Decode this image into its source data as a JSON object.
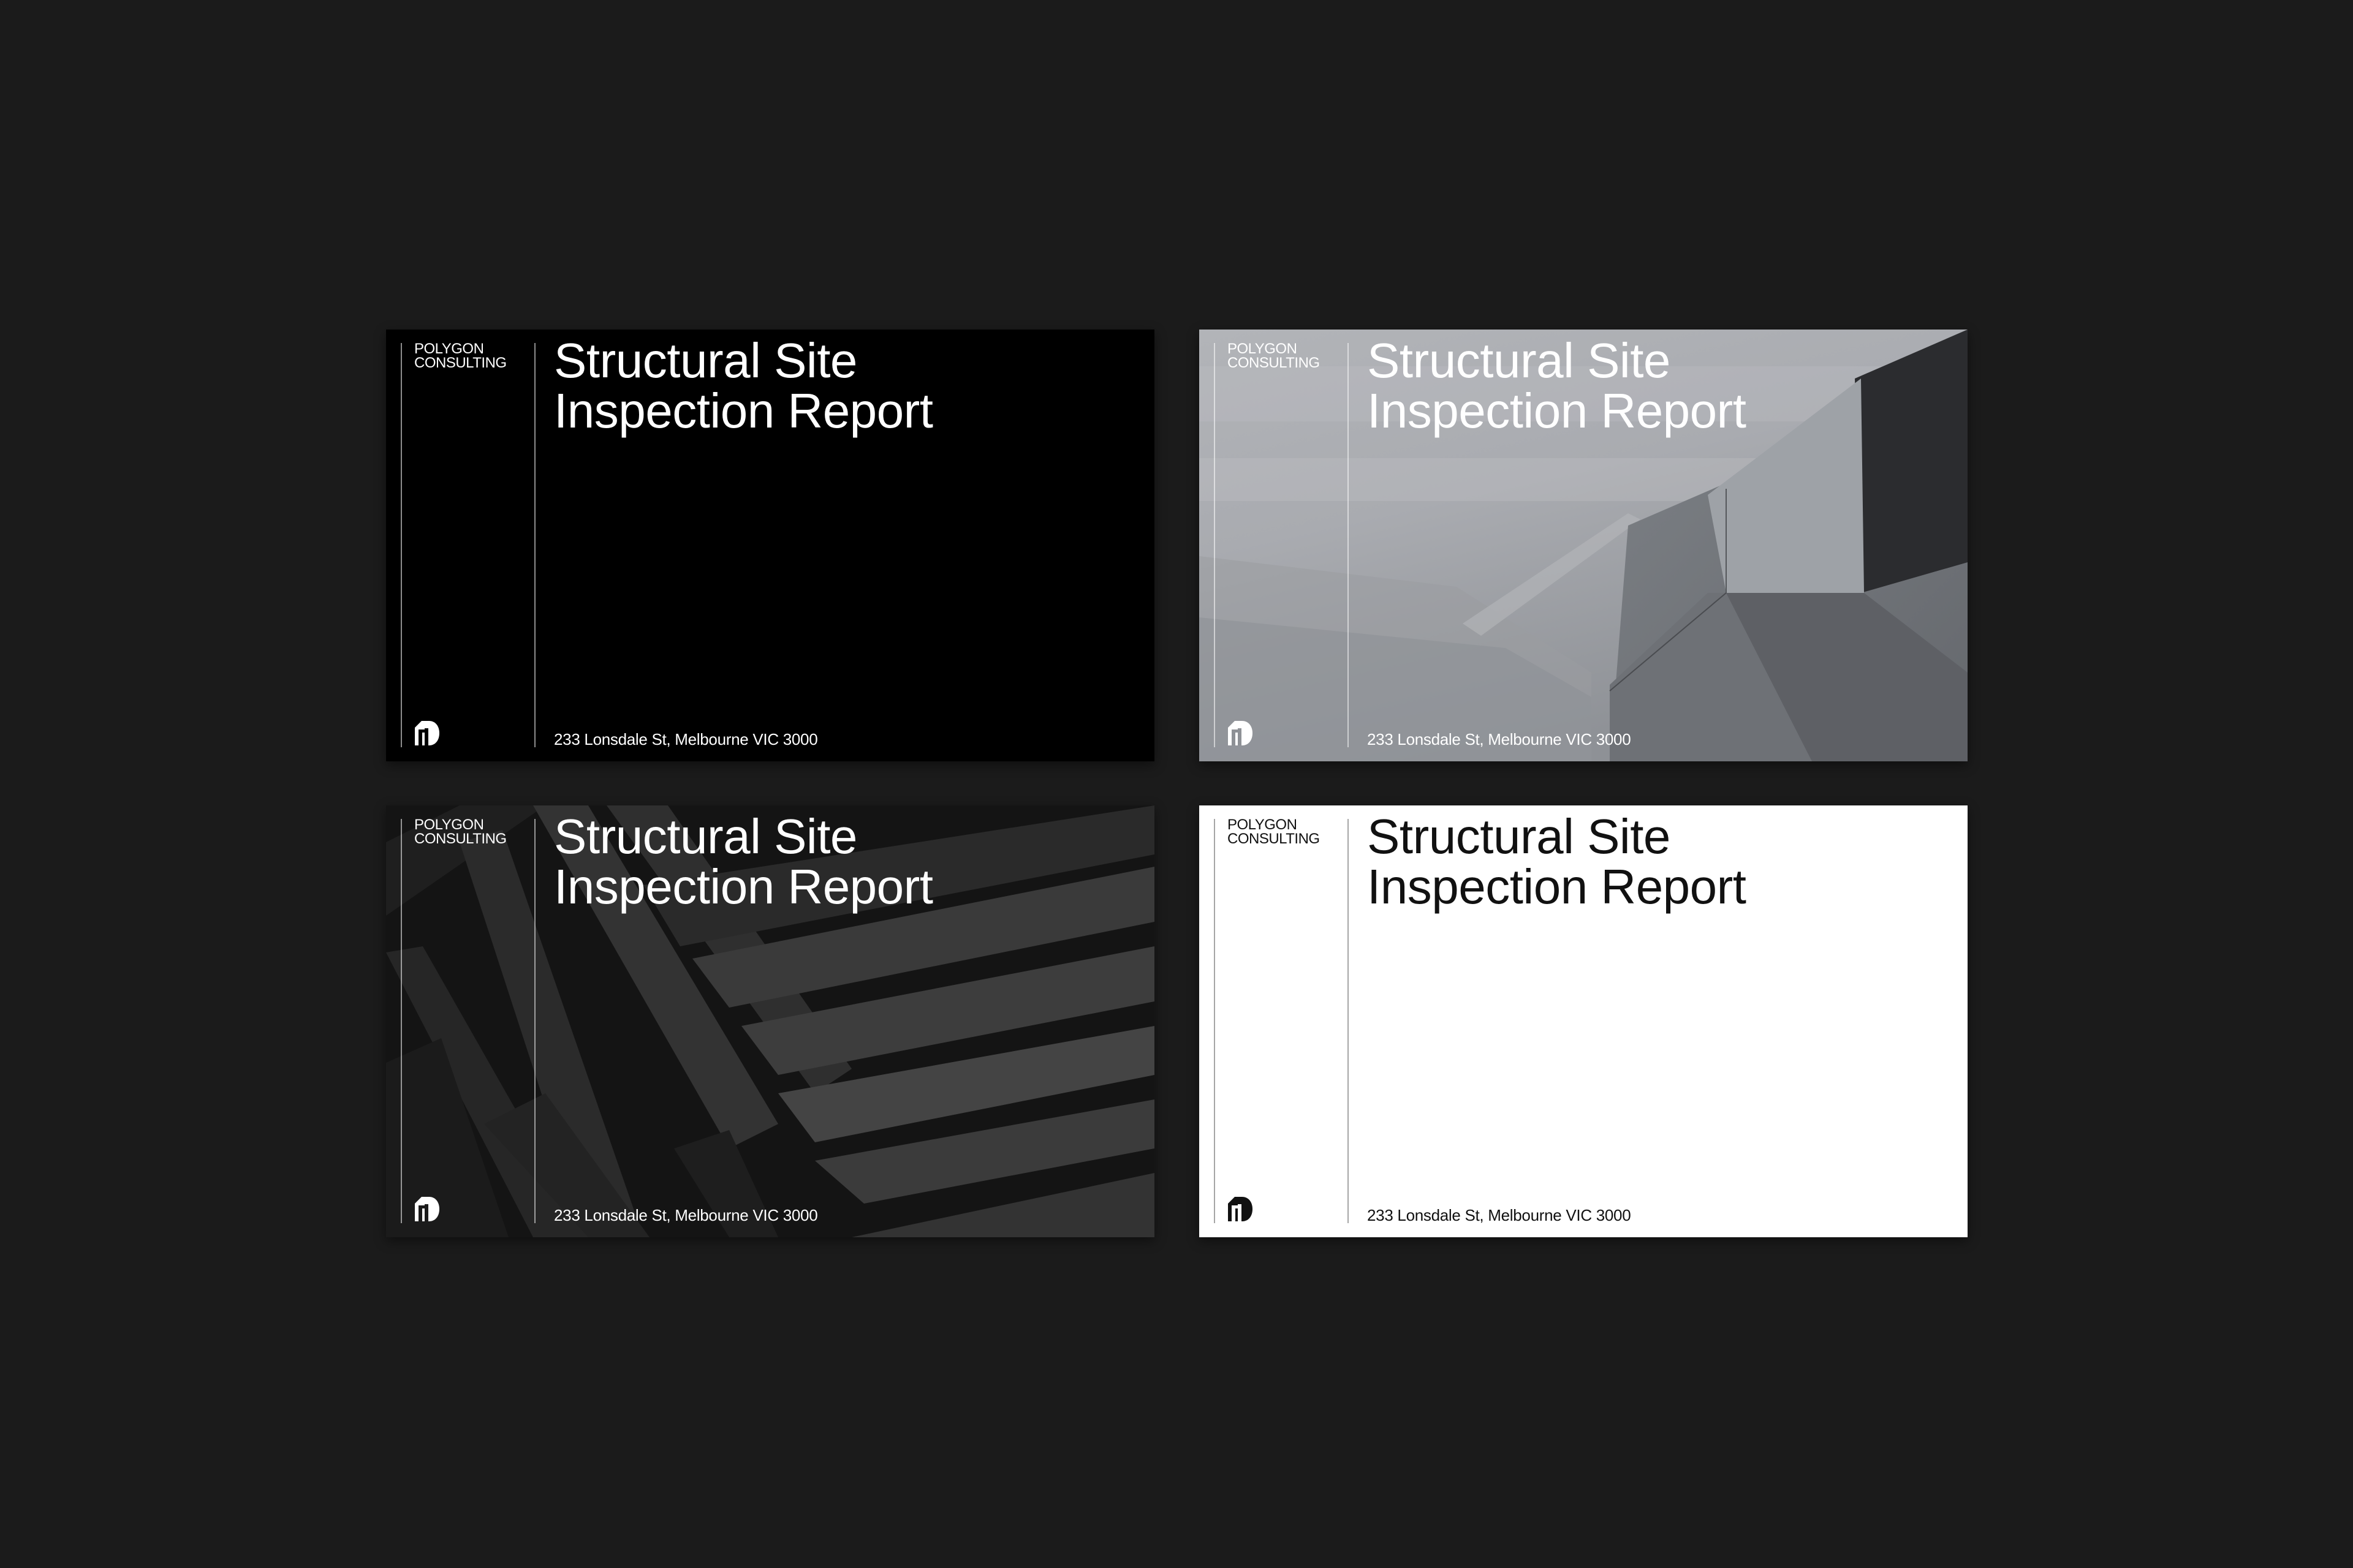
{
  "cards": [
    {
      "brand": "POLYGON\nCONSULTING",
      "title": "Structural Site\nInspection Report",
      "address": "233 Lonsdale St, Melbourne VIC 3000"
    },
    {
      "brand": "POLYGON\nCONSULTING",
      "title": "Structural Site\nInspection Report",
      "address": "233 Lonsdale St, Melbourne VIC 3000"
    },
    {
      "brand": "POLYGON\nCONSULTING",
      "title": "Structural Site\nInspection Report",
      "address": "233 Lonsdale St, Melbourne VIC 3000"
    },
    {
      "brand": "POLYGON\nCONSULTING",
      "title": "Structural Site\nInspection Report",
      "address": "233 Lonsdale St, Melbourne VIC 3000"
    }
  ],
  "colors": {
    "page_background": "#1b1b1b",
    "card_black": "#000000",
    "card_white": "#ffffff",
    "text_light": "#ffffff",
    "text_dark": "#111111"
  },
  "icons": {
    "logo": "polygon-logo-icon"
  }
}
